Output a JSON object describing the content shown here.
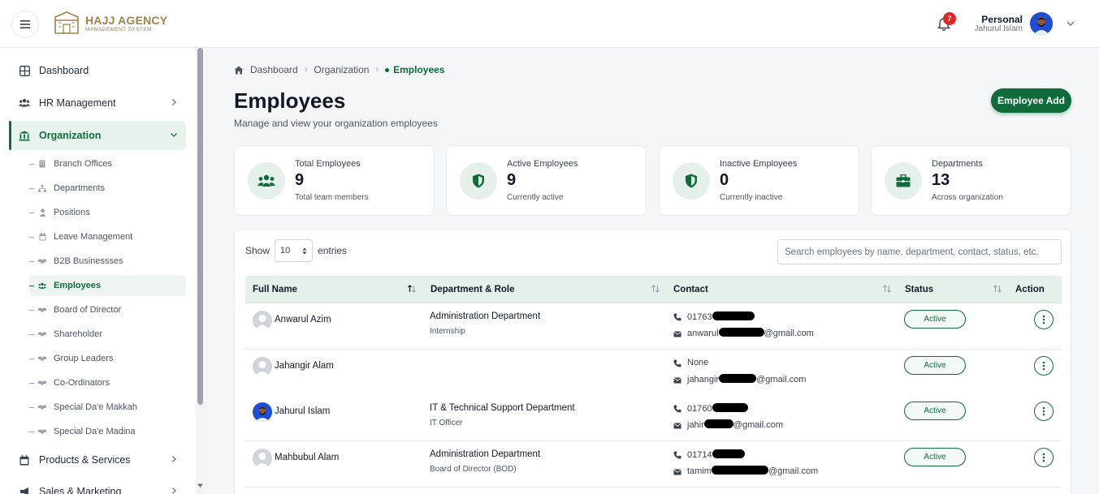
{
  "brand": {
    "title": "HAJJ AGENCY",
    "subtitle": "MANAGEMENT SYSTEM"
  },
  "header": {
    "notifications_count": "7",
    "user_role": "Personal",
    "user_name": "Jahurul Islam"
  },
  "sidebar": {
    "items": [
      {
        "label": "Dashboard"
      },
      {
        "label": "HR Management"
      },
      {
        "label": "Organization"
      },
      {
        "label": "Products & Services"
      },
      {
        "label": "Sales & Marketing"
      }
    ],
    "sub_items": [
      {
        "label": "Branch Offices"
      },
      {
        "label": "Departments"
      },
      {
        "label": "Positions"
      },
      {
        "label": "Leave Management"
      },
      {
        "label": "B2B Businessses"
      },
      {
        "label": "Employees"
      },
      {
        "label": "Board of Director"
      },
      {
        "label": "Shareholder"
      },
      {
        "label": "Group Leaders"
      },
      {
        "label": "Co-Ordinators"
      },
      {
        "label": "Special Da'e Makkah"
      },
      {
        "label": "Special Da'e Madina"
      }
    ]
  },
  "breadcrumb": [
    "Dashboard",
    "Organization",
    "Employees"
  ],
  "page": {
    "title": "Employees",
    "subtitle": "Manage and view your organization employees",
    "add_button": "Employee Add"
  },
  "stats": [
    {
      "label": "Total Employees",
      "value": "9",
      "note": "Total team members"
    },
    {
      "label": "Active Employees",
      "value": "9",
      "note": "Currently active"
    },
    {
      "label": "Inactive Employees",
      "value": "0",
      "note": "Currently inactive"
    },
    {
      "label": "Departments",
      "value": "13",
      "note": "Across organization"
    }
  ],
  "table": {
    "show_label": "Show",
    "entries_value": "10",
    "entries_label": "entries",
    "search_placeholder": "Search employees by name, department, contact, status, etc.",
    "columns": [
      "Full Name",
      "Department & Role",
      "Contact",
      "Status",
      "Action"
    ],
    "rows": [
      {
        "name": "Anwarul Azim",
        "department": "Administration Department",
        "role": "Internship",
        "phone": "01763",
        "email_prefix": "anwarul",
        "email_suffix": "@gmail.com",
        "status": "Active"
      },
      {
        "name": "Jahangir Alam",
        "department": "",
        "role": "",
        "phone": "None",
        "email_prefix": "jahangir",
        "email_suffix": "@gmail.com",
        "status": "Active"
      },
      {
        "name": "Jahurul Islam",
        "department": "IT & Technical Support Department",
        "role": "IT Officer",
        "phone": "01760",
        "email_prefix": "jahir",
        "email_suffix": "@gmail.com",
        "status": "Active"
      },
      {
        "name": "Mahbubul Alam",
        "department": "Administration Department",
        "role": "Board of Director (BOD)",
        "phone": "01714",
        "email_prefix": "tamim",
        "email_suffix": "@gmail.com",
        "status": "Active"
      }
    ]
  },
  "colors": {
    "primary": "#0f6b3c",
    "primary_light": "#e6f0ea",
    "badge": "#e02424",
    "brand_gold": "#a0834a"
  }
}
